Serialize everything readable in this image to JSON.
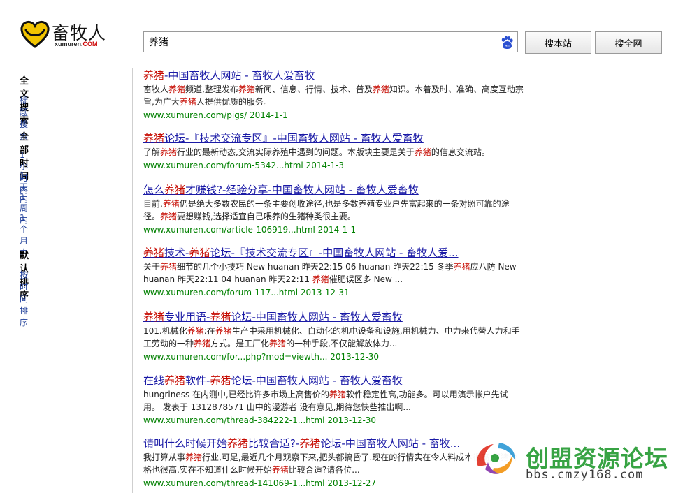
{
  "brand": {
    "name": "畜牧人",
    "domain_main": "xumuren.",
    "domain_tld": "COM"
  },
  "search": {
    "query": "养猪",
    "btn_site": "搜本站",
    "btn_web": "搜全网"
  },
  "sidebar": {
    "groups": [
      {
        "heading": "全文搜索",
        "links": [
          "标题搜索"
        ]
      },
      {
        "heading": "全部时间",
        "links": [
          "1小时内",
          "1天内",
          "1周内",
          "1个月内"
        ]
      },
      {
        "heading": "默认排序",
        "links": [
          "按时间排序"
        ]
      }
    ]
  },
  "results": [
    {
      "title": "[[养猪]]-中国畜牧人网站 - 畜牧人爱畜牧",
      "snippet": "畜牧人[[养猪]]频道,整理发布[[养猪]]新闻、信息、行情、技术、普及[[养猪]]知识。本着及时、准确、高度互动宗旨,为广大[[养猪]]人提供优质的服务。",
      "url": "www.xumuren.com/pigs/ 2014-1-1"
    },
    {
      "title": "[[养猪]]论坛-『技术交流专区』-中国畜牧人网站 - 畜牧人爱畜牧",
      "snippet": "了解[[养猪]]行业的最新动态,交流实际养殖中遇到的问题。本版块主要是关于[[养猪]]的信息交流站。",
      "url": "www.xumuren.com/forum-5342...html 2014-1-3"
    },
    {
      "title": "怎么[[养猪]]才赚钱?-经验分享-中国畜牧人网站 - 畜牧人爱畜牧",
      "snippet": "目前,[[养猪]]仍是绝大多数农民的一条主要创收途径,也是多数养殖专业户先富起来的一条对照可靠的途径。[[养猪]]要想赚钱,选择适宜自己喂养的生猪种类很主要。",
      "url": "www.xumuren.com/article-106919...html 2014-1-1"
    },
    {
      "title": "[[养猪]]技术-[[养猪]]论坛-『技术交流专区』-中国畜牧人网站 - 畜牧人爱...",
      "snippet": "关于[[养猪]]细节的几个小技巧 New huanan 昨天22:15 06 huanan 昨天22:15 冬季[[养猪]]应八防 New huanan 昨天22:11 04 huanan 昨天22:11 [[养猪]]催肥误区多 New ...",
      "url": "www.xumuren.com/forum-117...html 2013-12-31"
    },
    {
      "title": "[[养猪]]专业用语-[[养猪]]论坛-中国畜牧人网站 - 畜牧人爱畜牧",
      "snippet": "101.机械化[[养猪]]:在[[养猪]]生产中采用机械化、自动化的机电设备和设施,用机械力、电力来代替人力和手工劳动的一种[[养猪]]方式。是工厂化[[养猪]]的一种手段,不仅能解放体力...",
      "url": "www.xumuren.com/for...php?mod=viewth... 2013-12-30"
    },
    {
      "title": "在线[[养猪]]软件-[[养猪]]论坛-中国畜牧人网站 - 畜牧人爱畜牧",
      "snippet": "hungriness 在内测中,已经比许多市场上高售价的[[养猪]]软件稳定性高,功能多。可以用演示帐户先试用。 发表于 1312878571 山中的漫游者 没有意见,期待您快些推出啊...",
      "url": "www.xumuren.com/thread-384222-1...html 2013-12-30"
    },
    {
      "title": "请叫什么时候开始[[养猪]]比较合适?-[[养猪]]论坛-中国畜牧人网站 - 畜牧...",
      "snippet": "我打算从事[[养猪]]行业,可是,最近几个月观察下来,把头都搞昏了.现在的行情实在令人料成本很高,仔猪价格也很高,实在不知道什么时候开始[[养猪]]比较合适?请各位...",
      "url": "www.xumuren.com/thread-141069-1...html 2013-12-27"
    }
  ],
  "watermark": {
    "text": "创盟资源论坛",
    "url": "bbs.cmzy168.com"
  },
  "colors": {
    "title_link": "#1a1aa6",
    "highlight": "#c60a00",
    "url_green": "#008000",
    "sidebar_link": "#1f3f99",
    "watermark_green": "#2fa03c"
  }
}
